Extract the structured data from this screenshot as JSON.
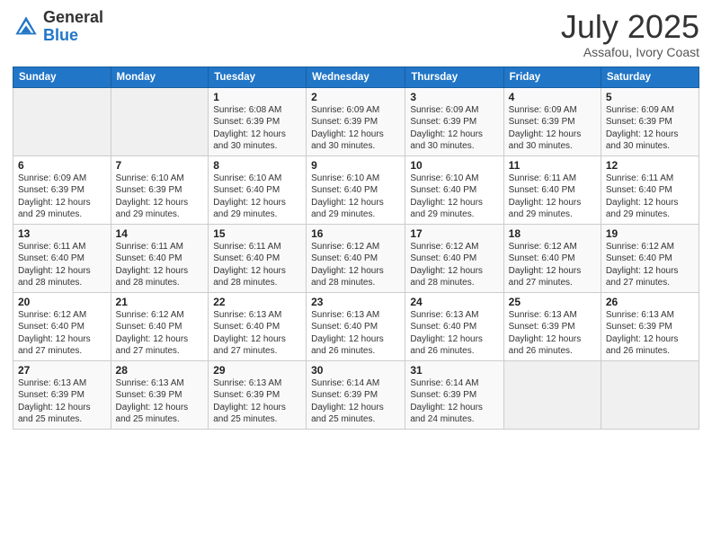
{
  "logo": {
    "general": "General",
    "blue": "Blue"
  },
  "title": "July 2025",
  "subtitle": "Assafou, Ivory Coast",
  "header_days": [
    "Sunday",
    "Monday",
    "Tuesday",
    "Wednesday",
    "Thursday",
    "Friday",
    "Saturday"
  ],
  "weeks": [
    [
      {
        "day": "",
        "info": ""
      },
      {
        "day": "",
        "info": ""
      },
      {
        "day": "1",
        "info": "Sunrise: 6:08 AM\nSunset: 6:39 PM\nDaylight: 12 hours and 30 minutes."
      },
      {
        "day": "2",
        "info": "Sunrise: 6:09 AM\nSunset: 6:39 PM\nDaylight: 12 hours and 30 minutes."
      },
      {
        "day": "3",
        "info": "Sunrise: 6:09 AM\nSunset: 6:39 PM\nDaylight: 12 hours and 30 minutes."
      },
      {
        "day": "4",
        "info": "Sunrise: 6:09 AM\nSunset: 6:39 PM\nDaylight: 12 hours and 30 minutes."
      },
      {
        "day": "5",
        "info": "Sunrise: 6:09 AM\nSunset: 6:39 PM\nDaylight: 12 hours and 30 minutes."
      }
    ],
    [
      {
        "day": "6",
        "info": "Sunrise: 6:09 AM\nSunset: 6:39 PM\nDaylight: 12 hours and 29 minutes."
      },
      {
        "day": "7",
        "info": "Sunrise: 6:10 AM\nSunset: 6:39 PM\nDaylight: 12 hours and 29 minutes."
      },
      {
        "day": "8",
        "info": "Sunrise: 6:10 AM\nSunset: 6:40 PM\nDaylight: 12 hours and 29 minutes."
      },
      {
        "day": "9",
        "info": "Sunrise: 6:10 AM\nSunset: 6:40 PM\nDaylight: 12 hours and 29 minutes."
      },
      {
        "day": "10",
        "info": "Sunrise: 6:10 AM\nSunset: 6:40 PM\nDaylight: 12 hours and 29 minutes."
      },
      {
        "day": "11",
        "info": "Sunrise: 6:11 AM\nSunset: 6:40 PM\nDaylight: 12 hours and 29 minutes."
      },
      {
        "day": "12",
        "info": "Sunrise: 6:11 AM\nSunset: 6:40 PM\nDaylight: 12 hours and 29 minutes."
      }
    ],
    [
      {
        "day": "13",
        "info": "Sunrise: 6:11 AM\nSunset: 6:40 PM\nDaylight: 12 hours and 28 minutes."
      },
      {
        "day": "14",
        "info": "Sunrise: 6:11 AM\nSunset: 6:40 PM\nDaylight: 12 hours and 28 minutes."
      },
      {
        "day": "15",
        "info": "Sunrise: 6:11 AM\nSunset: 6:40 PM\nDaylight: 12 hours and 28 minutes."
      },
      {
        "day": "16",
        "info": "Sunrise: 6:12 AM\nSunset: 6:40 PM\nDaylight: 12 hours and 28 minutes."
      },
      {
        "day": "17",
        "info": "Sunrise: 6:12 AM\nSunset: 6:40 PM\nDaylight: 12 hours and 28 minutes."
      },
      {
        "day": "18",
        "info": "Sunrise: 6:12 AM\nSunset: 6:40 PM\nDaylight: 12 hours and 27 minutes."
      },
      {
        "day": "19",
        "info": "Sunrise: 6:12 AM\nSunset: 6:40 PM\nDaylight: 12 hours and 27 minutes."
      }
    ],
    [
      {
        "day": "20",
        "info": "Sunrise: 6:12 AM\nSunset: 6:40 PM\nDaylight: 12 hours and 27 minutes."
      },
      {
        "day": "21",
        "info": "Sunrise: 6:12 AM\nSunset: 6:40 PM\nDaylight: 12 hours and 27 minutes."
      },
      {
        "day": "22",
        "info": "Sunrise: 6:13 AM\nSunset: 6:40 PM\nDaylight: 12 hours and 27 minutes."
      },
      {
        "day": "23",
        "info": "Sunrise: 6:13 AM\nSunset: 6:40 PM\nDaylight: 12 hours and 26 minutes."
      },
      {
        "day": "24",
        "info": "Sunrise: 6:13 AM\nSunset: 6:40 PM\nDaylight: 12 hours and 26 minutes."
      },
      {
        "day": "25",
        "info": "Sunrise: 6:13 AM\nSunset: 6:39 PM\nDaylight: 12 hours and 26 minutes."
      },
      {
        "day": "26",
        "info": "Sunrise: 6:13 AM\nSunset: 6:39 PM\nDaylight: 12 hours and 26 minutes."
      }
    ],
    [
      {
        "day": "27",
        "info": "Sunrise: 6:13 AM\nSunset: 6:39 PM\nDaylight: 12 hours and 25 minutes."
      },
      {
        "day": "28",
        "info": "Sunrise: 6:13 AM\nSunset: 6:39 PM\nDaylight: 12 hours and 25 minutes."
      },
      {
        "day": "29",
        "info": "Sunrise: 6:13 AM\nSunset: 6:39 PM\nDaylight: 12 hours and 25 minutes."
      },
      {
        "day": "30",
        "info": "Sunrise: 6:14 AM\nSunset: 6:39 PM\nDaylight: 12 hours and 25 minutes."
      },
      {
        "day": "31",
        "info": "Sunrise: 6:14 AM\nSunset: 6:39 PM\nDaylight: 12 hours and 24 minutes."
      },
      {
        "day": "",
        "info": ""
      },
      {
        "day": "",
        "info": ""
      }
    ]
  ]
}
